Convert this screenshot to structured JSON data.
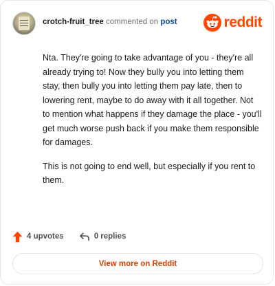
{
  "header": {
    "username": "crotch-fruit_tree",
    "action_text": "commented on",
    "post_link": "post",
    "brand_name": "reddit"
  },
  "comment": {
    "paragraphs": [
      "Nta. They're going to take advantage of you - they're all already trying to! Now they bully you into letting them stay, then bully you into letting them pay late, then to lowering rent, maybe to do away with it all together. Not to mention what happens if they damage the place - you'll get much worse push back if you make them responsible for damages.",
      "This is not going to end well, but especially if you rent to them."
    ]
  },
  "stats": {
    "upvotes": "4 upvotes",
    "replies": "0 replies"
  },
  "footer": {
    "view_more_label": "View more on Reddit"
  },
  "colors": {
    "brand": "#ff4500",
    "link": "#0f4aa3",
    "view_more_text": "#d94100"
  },
  "icons": {
    "avatar": "user-avatar",
    "brand": "reddit-logo-icon",
    "upvote": "upvote-arrow-icon",
    "reply": "reply-arrow-icon"
  }
}
